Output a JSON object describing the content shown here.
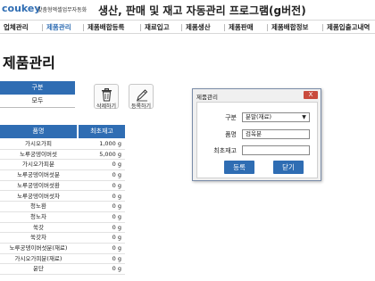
{
  "header": {
    "logo": "coukey",
    "logo_sub": "맞춤형엑셀업무자동화",
    "title": "생산, 판매 및 재고 자동관리 프로그램(g버전)"
  },
  "menu": [
    {
      "label": "업체관리",
      "active": false
    },
    {
      "label": "제품관리",
      "active": true
    },
    {
      "label": "제품배합등록",
      "active": false
    },
    {
      "label": "재료입고",
      "active": false
    },
    {
      "label": "제품생산",
      "active": false
    },
    {
      "label": "제품판매",
      "active": false
    },
    {
      "label": "제품배합정보",
      "active": false
    },
    {
      "label": "제품입출고내역",
      "active": false
    }
  ],
  "page_title": "제품관리",
  "filter": {
    "header": "구분",
    "value": "모두"
  },
  "toolbar": {
    "delete_label": "삭제하기",
    "register_label": "등록하기"
  },
  "table": {
    "columns": [
      "품명",
      "최초재고"
    ],
    "rows": [
      {
        "name": "가시오가피",
        "stock": "1,000 g"
      },
      {
        "name": "노루궁뎅이버섯",
        "stock": "5,000 g"
      },
      {
        "name": "가시오가피분",
        "stock": "0 g"
      },
      {
        "name": "노루궁뎅이버섯분",
        "stock": "0 g"
      },
      {
        "name": "노루궁뎅이버섯환",
        "stock": "0 g"
      },
      {
        "name": "노루궁뎅이버섯차",
        "stock": "0 g"
      },
      {
        "name": "청노환",
        "stock": "0 g"
      },
      {
        "name": "청노차",
        "stock": "0 g"
      },
      {
        "name": "쑥갓",
        "stock": "0 g"
      },
      {
        "name": "쑥갓차",
        "stock": "0 g"
      },
      {
        "name": "노루궁뎅이버섯분(재료)",
        "stock": "0 g"
      },
      {
        "name": "가시오가피분(재료)",
        "stock": "0 g"
      },
      {
        "name": "윤단",
        "stock": "0 g"
      }
    ]
  },
  "dialog": {
    "title": "제품관리",
    "close": "X",
    "category_label": "구분",
    "category_value": "분말(재료)",
    "name_label": "품명",
    "name_value": "검옥분",
    "stock_label": "최초재고",
    "stock_value": "",
    "register_button": "등록",
    "close_button": "닫기"
  },
  "colors": {
    "accent": "#2f6db3",
    "close": "#c94a3c"
  }
}
